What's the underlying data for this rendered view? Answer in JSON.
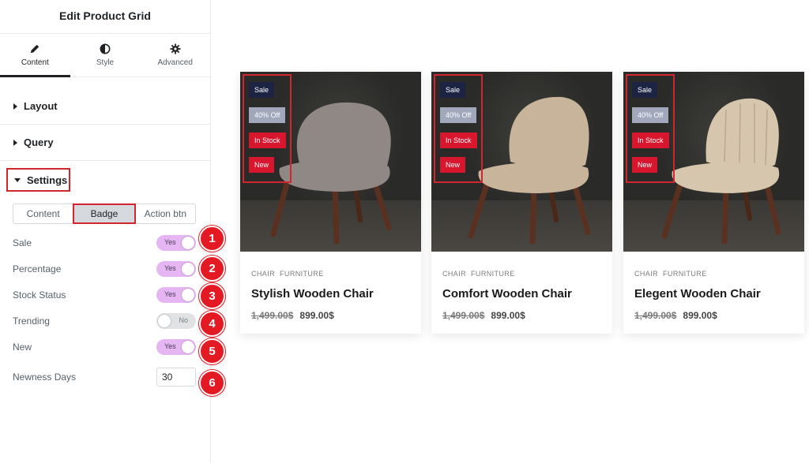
{
  "panel": {
    "title": "Edit Product Grid",
    "tabs": [
      {
        "label": "Content",
        "icon": "pencil-icon"
      },
      {
        "label": "Style",
        "icon": "half-circle-icon"
      },
      {
        "label": "Advanced",
        "icon": "gear-icon"
      }
    ],
    "sections": [
      "Layout",
      "Query",
      "Settings"
    ],
    "subtabs": [
      "Content",
      "Badge",
      "Action btn"
    ],
    "controls": [
      {
        "label": "Sale",
        "type": "toggle",
        "value": "Yes"
      },
      {
        "label": "Percentage",
        "type": "toggle",
        "value": "Yes"
      },
      {
        "label": "Stock Status",
        "type": "toggle",
        "value": "Yes"
      },
      {
        "label": "Trending",
        "type": "toggle",
        "value": "No"
      },
      {
        "label": "New",
        "type": "toggle",
        "value": "Yes"
      },
      {
        "label": "Newness Days",
        "type": "number",
        "value": "30"
      }
    ],
    "markers": [
      "1",
      "2",
      "3",
      "4",
      "5",
      "6"
    ]
  },
  "products": [
    {
      "categories": [
        "CHAIR",
        "FURNITURE"
      ],
      "name": "Stylish Wooden Chair",
      "old_price": "1,499.00$",
      "price": "899.00$",
      "badges": [
        "Sale",
        "40% Off",
        "In Stock",
        "New"
      ],
      "chair_color": "#8f8884"
    },
    {
      "categories": [
        "CHAIR",
        "FURNITURE"
      ],
      "name": "Comfort Wooden Chair",
      "old_price": "1,499.00$",
      "price": "899.00$",
      "badges": [
        "Sale",
        "40% Off",
        "In Stock",
        "New"
      ],
      "chair_color": "#c8b39b"
    },
    {
      "categories": [
        "CHAIR",
        "FURNITURE"
      ],
      "name": "Elegent Wooden Chair",
      "old_price": "1,499.00$",
      "price": "899.00$",
      "badges": [
        "Sale",
        "40% Off",
        "In Stock",
        "New"
      ],
      "chair_color": "#d6c6ad"
    }
  ],
  "colors": {
    "accent_red": "#e31a23",
    "toggle_on": "#e6b6f3",
    "badge_sale": "#1d2343",
    "badge_percent": "#a1a8bc",
    "badge_stock_new": "#d8172f"
  }
}
